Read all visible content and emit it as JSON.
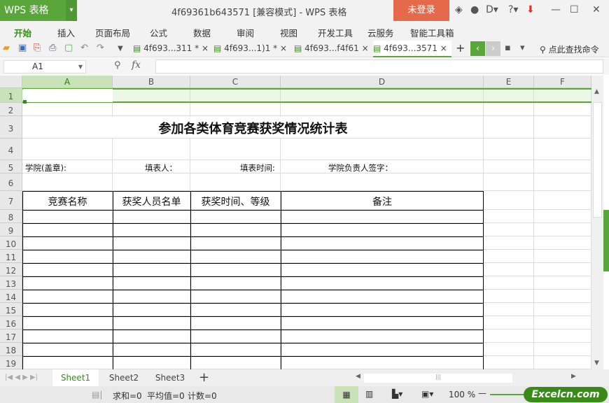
{
  "app": {
    "logo": "WPS 表格",
    "title": "4f69361b643571 [兼容模式] - WPS 表格",
    "login": "未登录"
  },
  "menu": [
    "开始",
    "插入",
    "页面布局",
    "公式",
    "数据",
    "审阅",
    "视图",
    "开发工具",
    "云服务",
    "智能工具箱"
  ],
  "doc_tabs": [
    "4f693...311 *",
    "4f693...1)1 *",
    "4f693...f4f61",
    "4f693...3571"
  ],
  "search": "点此查找命令",
  "formula": {
    "namebox": "A1",
    "fx": "fx",
    "value": ""
  },
  "columns": [
    "A",
    "B",
    "C",
    "D",
    "E",
    "F"
  ],
  "rows": [
    "1",
    "2",
    "3",
    "4",
    "5",
    "6",
    "7",
    "8",
    "9",
    "10",
    "11",
    "12",
    "13",
    "14",
    "15",
    "16",
    "17",
    "18",
    "19"
  ],
  "sheet": {
    "title": "参加各类体育竞赛获奖情况统计表",
    "info": [
      "学院(盖章):",
      "填表人：",
      "填表时间:",
      "学院负责人签字："
    ],
    "headers": [
      "竞赛名称",
      "获奖人员名单",
      "获奖时间、等级",
      "备注"
    ]
  },
  "sheet_tabs": [
    "Sheet1",
    "Sheet2",
    "Sheet3"
  ],
  "status": {
    "sum": "求和=0",
    "avg": "平均值=0",
    "count": "计数=0",
    "zoom": "100 %",
    "watermark": "Excelcn.com"
  },
  "colors": {
    "accent": "#5aa63a",
    "login": "#e46a4b"
  }
}
